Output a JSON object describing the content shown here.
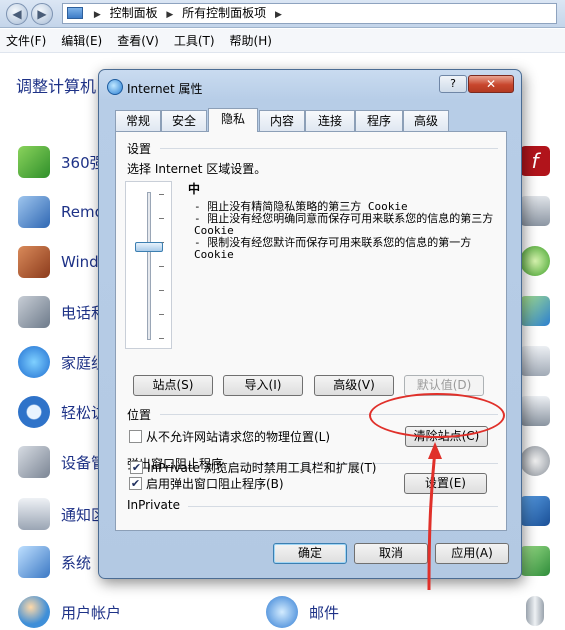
{
  "explorer": {
    "breadcrumb": [
      "控制面板",
      "所有控制面板项"
    ],
    "menu": [
      "文件(F)",
      "编辑(E)",
      "查看(V)",
      "工具(T)",
      "帮助(H)"
    ],
    "content_title": "调整计算机",
    "items": [
      {
        "label": "360强",
        "icon": "shield-360-icon"
      },
      {
        "label": "Remo",
        "icon": "remote-desktop-icon"
      },
      {
        "label": "Wind",
        "icon": "firewall-icon"
      },
      {
        "label": "电话和",
        "icon": "phone-modem-icon"
      },
      {
        "label": "家庭组",
        "icon": "homegroup-icon"
      },
      {
        "label": "轻松访",
        "icon": "ease-of-access-icon"
      },
      {
        "label": "设备管",
        "icon": "device-manager-icon"
      },
      {
        "label": "通知区",
        "icon": "notification-area-icon"
      },
      {
        "label": "系统",
        "icon": "system-icon"
      },
      {
        "label": "用户帐户",
        "icon": "user-accounts-icon"
      }
    ],
    "mail_label": "邮件"
  },
  "dialog": {
    "title": "Internet 属性",
    "help": "?",
    "close": "✕",
    "tabs": [
      "常规",
      "安全",
      "隐私",
      "内容",
      "连接",
      "程序",
      "高级"
    ],
    "active_tab": "隐私",
    "settings": {
      "group": "设置",
      "instruction": "选择 Internet 区域设置。",
      "level": "中",
      "descriptions": [
        "- 阻止没有精简隐私策略的第三方 Cookie",
        "- 阻止没有经您明确同意而保存可用来联系您的信息的第三方 Cookie",
        "- 限制没有经您默许而保存可用来联系您的信息的第一方 Cookie"
      ],
      "buttons": {
        "sites": "站点(S)",
        "import": "导入(I)",
        "advanced": "高级(V)",
        "default": "默认值(D)"
      }
    },
    "location": {
      "group": "位置",
      "never_allow": "从不允许网站请求您的物理位置(L)",
      "never_allow_checked": false,
      "clear_sites": "清除站点(C)"
    },
    "popup": {
      "group": "弹出窗口阻止程序",
      "enable": "启用弹出窗口阻止程序(B)",
      "enable_checked": true,
      "settings": "设置(E)"
    },
    "inprivate": {
      "group": "InPrivate",
      "disable_toolbars": "InPrivate 浏览启动时禁用工具栏和扩展(T)",
      "disable_checked": true
    },
    "footer": {
      "ok": "确定",
      "cancel": "取消",
      "apply": "应用(A)"
    }
  },
  "colors": {
    "accent_link": "#1e3287",
    "annotation_red": "#e0302a"
  }
}
